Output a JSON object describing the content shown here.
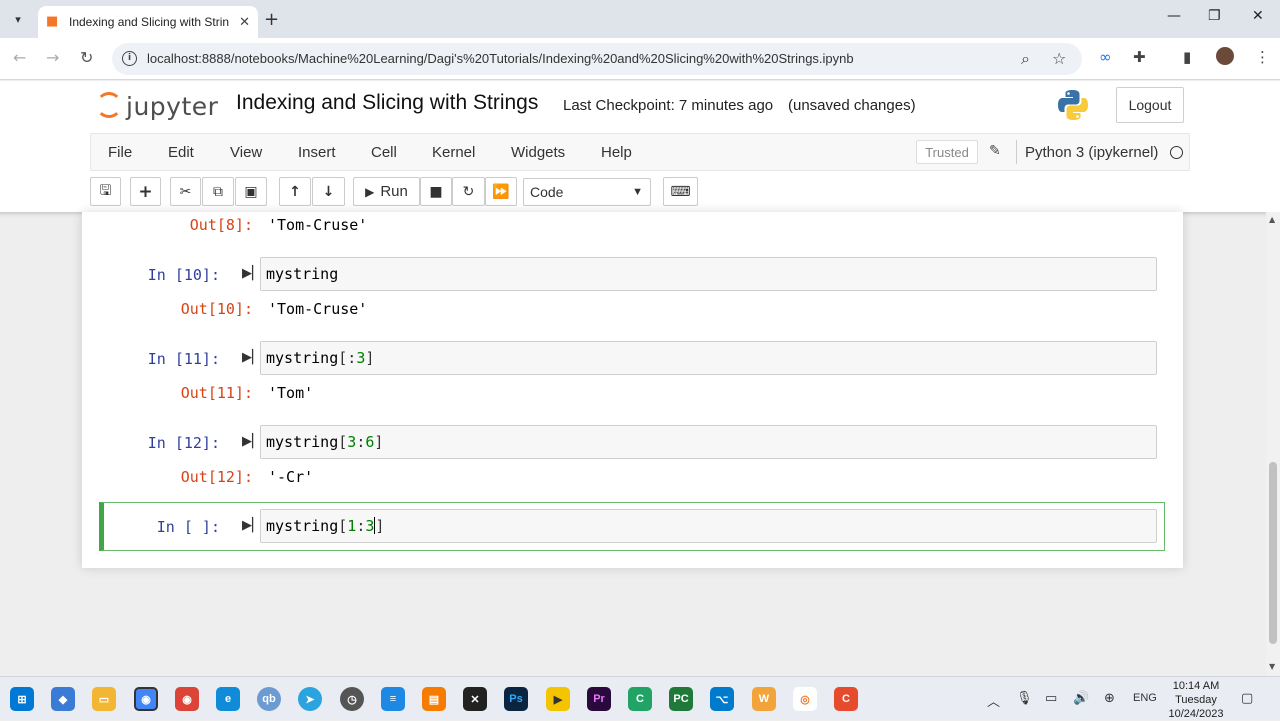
{
  "browser": {
    "tab_title": "Indexing and Slicing with Strings",
    "url": "localhost:8888/notebooks/Machine%20Learning/Dagi's%20Tutorials/Indexing%20and%20Slicing%20with%20Strings.ipynb"
  },
  "header": {
    "logo_text": "jupyter",
    "notebook_name": "Indexing and Slicing with Strings",
    "checkpoint": "Last Checkpoint: 7 minutes ago",
    "status": "(unsaved changes)",
    "logout_label": "Logout"
  },
  "menu": {
    "items": [
      "File",
      "Edit",
      "View",
      "Insert",
      "Cell",
      "Kernel",
      "Widgets",
      "Help"
    ],
    "trusted_label": "Trusted",
    "kernel_name": "Python 3 (ipykernel)"
  },
  "toolbar": {
    "run_label": "Run",
    "cell_type": "Code"
  },
  "cells": {
    "out8": {
      "prompt": "Out[8]:",
      "text": "'Tom-Cruse'"
    },
    "c10": {
      "in_prompt": "In [10]:",
      "code": "mystring",
      "out_prompt": "Out[10]:",
      "output": "'Tom-Cruse'"
    },
    "c11": {
      "in_prompt": "In [11]:",
      "code_name": "mystring",
      "code_open": "[:",
      "code_n1": "3",
      "code_close": "]",
      "out_prompt": "Out[11]:",
      "output": "'Tom'"
    },
    "c12": {
      "in_prompt": "In [12]:",
      "code_name": "mystring",
      "code_open": "[",
      "code_n1": "3",
      "code_colon": ":",
      "code_n2": "6",
      "code_close": "]",
      "out_prompt": "Out[12]:",
      "output": "'-Cr'"
    },
    "active": {
      "in_prompt": "In [ ]:",
      "code_name": "mystring",
      "code_open": "[",
      "code_n1": "1",
      "code_colon": ":",
      "code_n2": "3",
      "code_close": "]"
    }
  },
  "taskbar": {
    "lang": "ENG",
    "time": "10:14 AM",
    "day": "Tuesday",
    "date": "10/24/2023"
  },
  "colors": {
    "jupyter_orange": "#f37726",
    "in_prompt": "#303f9f",
    "out_prompt": "#d84315",
    "number": "#008000",
    "selected_border": "#42a548"
  }
}
